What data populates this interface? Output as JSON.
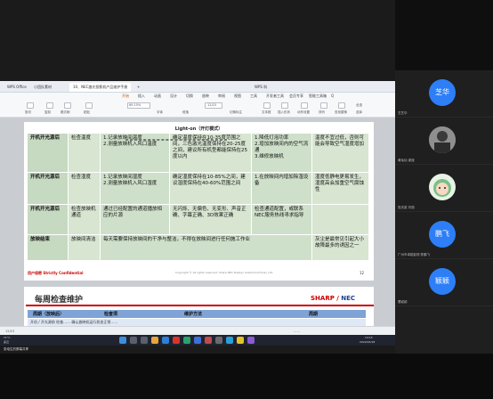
{
  "doc": {
    "tabs": [
      {
        "label": "WPS Office",
        "active": false
      },
      {
        "label": "小团队素材",
        "active": false
      },
      {
        "label": "10、NEC激光投影机产品维护手册",
        "active": true
      },
      {
        "label": "+",
        "active": false
      }
    ],
    "wps_label": "WPS 科",
    "menu": [
      "开始",
      "插入",
      "动画",
      "设计",
      "切换",
      "放映",
      "审阅",
      "视图",
      "工具",
      "开发者工具",
      "会员专享",
      "智能工具箱",
      "Q"
    ],
    "toolbar_labels": [
      "剪切",
      "复制",
      "格式刷",
      "粘贴",
      "字体",
      "段落",
      "行距",
      "对齐方式",
      "切换标注",
      "文本框",
      "插入形状",
      "动作设置",
      "排列",
      "查找替换",
      "全选",
      "选择"
    ],
    "zoom_value": "69.15%",
    "page_indicator": "12/15"
  },
  "slide": {
    "title": "Light-on（开灯模式）",
    "footer_left": "用户保密 Strictly Confidential",
    "footer_center": "Copyright © All rights reserved. Sharp NEC Display Solutions(China), Ltd.",
    "page_number": "12",
    "rows": [
      {
        "c0": "开机开光源后",
        "c1": "检查温度",
        "c2": "1.记录放映间温度\n2.测量放映机入风口温度",
        "c3": "确定温度保持在10-35度范围之间，三色激光温度保持在20-25度之间，建议所有机型都能保持在25度以内",
        "c4": "1.降低灯泡功率\n2.增加放映间内的空气流通\n3.维修放映机",
        "c5": "温度不宜过低，否则可能会导致空气湿度增加"
      },
      {
        "c0": "开机开光源后",
        "c1": "检查湿度",
        "c2": "1.记录放映间湿度\n2.测量放映机入风口湿度",
        "c3": "确定湿度保持在10-85%之间，建议湿度保持在40-60%范围之间",
        "c4": "1.在放映间内增加除湿设备",
        "c5": "湿度低静电更易发生，湿度高会加重空气腐蚀性"
      },
      {
        "c0": "开机开光源后",
        "c1": "检查放映机通道",
        "c2": "通过已经配置的通道播放相应的片源",
        "c3": "无闪烁、无偏色、无变形、声音正确、字幕正确、3D效果正确",
        "c4": "检查通道配置，或联系NEC服务热线寻求指导",
        "c5": ""
      },
      {
        "c0": "放映结束",
        "c1": "放映间清洁",
        "c2": "每天需要保持放映间的干净与整洁，不得在放映间进行任何施工作业",
        "c3": "",
        "c4": "",
        "c5": "灰尘是最常见引起大小故障最多的诱因之一"
      }
    ]
  },
  "slide2": {
    "title": "每周检查维护",
    "logo_main": "SHARP",
    "logo_sep": " / ",
    "logo_sub": "NEC",
    "headers": [
      "周期（放映后）",
      "检查项",
      "维护方法",
      "周期"
    ],
    "sub_text": "开机 / 开光源前   检查……   确认放映机运行状态正常……"
  },
  "status": {
    "left": "12/15",
    "right": "……"
  },
  "taskbar": {
    "temp": "11°C",
    "weather": "多云",
    "time": "14:15",
    "date": "2022/03/18"
  },
  "meeting": {
    "bottom_label": "张培生的屏幕共享"
  },
  "participants": [
    {
      "avatar_text": "芝华",
      "name": "芝芝华",
      "color": "#2d7ef7",
      "kind": "text"
    },
    {
      "avatar_text": "",
      "name": "黄灿灿 谢娅",
      "color": "#8a8a8a",
      "kind": "photo"
    },
    {
      "avatar_text": "",
      "name": "张庆梁 刘丽",
      "color": "#7bbf88",
      "kind": "doll"
    },
    {
      "avatar_text": "鹏飞",
      "name": "广州市卓越影视 陈鹏飞",
      "color": "#2d7ef7",
      "kind": "text"
    },
    {
      "avatar_text": "颖颖",
      "name": "曹颖颖",
      "color": "#2d7ef7",
      "kind": "text"
    }
  ]
}
